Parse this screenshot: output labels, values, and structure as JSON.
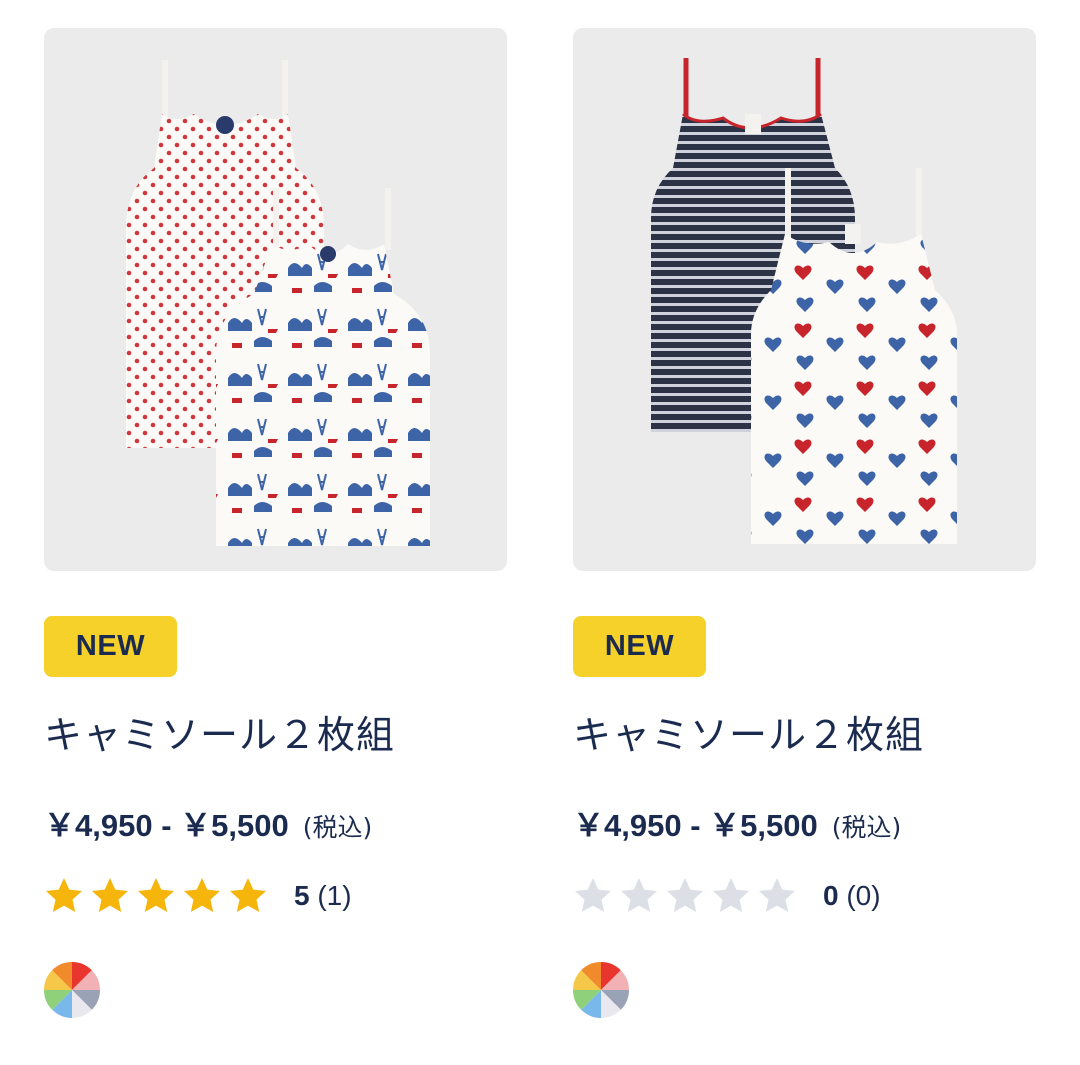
{
  "products": [
    {
      "badge": "NEW",
      "title": "キャミソール２枚組",
      "price_range": "￥4,950 - ￥5,500",
      "tax_note": "(税込)",
      "rating_score": "5",
      "review_count": "(1)",
      "rating_value": 5,
      "swatch_icon": "multicolor-swatch-icon"
    },
    {
      "badge": "NEW",
      "title": "キャミソール２枚組",
      "price_range": "￥4,950 - ￥5,500",
      "tax_note": "(税込)",
      "rating_score": "0",
      "review_count": "(0)",
      "rating_value": 0,
      "swatch_icon": "multicolor-swatch-icon"
    }
  ],
  "colors": {
    "text": "#1b2b4f",
    "badge_bg": "#f6d12a",
    "star_filled": "#f5b50a",
    "star_empty": "#dcdfe6",
    "image_bg": "#ecebeb"
  }
}
